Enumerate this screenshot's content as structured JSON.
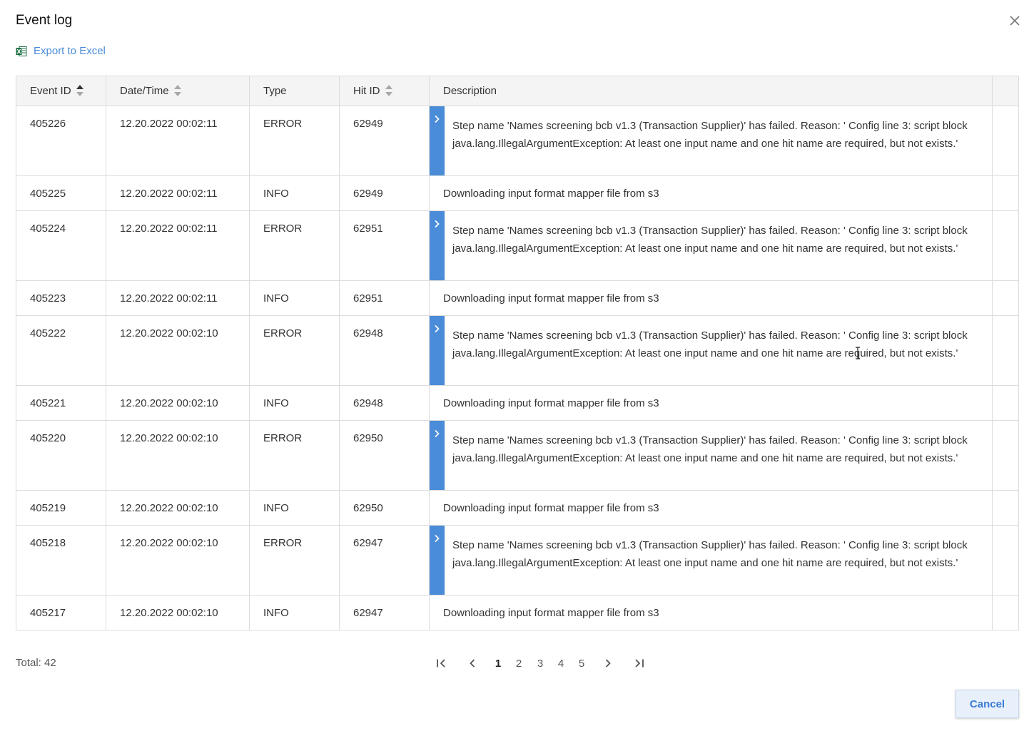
{
  "dialog": {
    "title": "Event log"
  },
  "toolbar": {
    "export_label": "Export to Excel"
  },
  "table": {
    "columns": [
      "Event ID",
      "Date/Time",
      "Type",
      "Hit ID",
      "Description"
    ],
    "rows": [
      {
        "id": "405226",
        "datetime": "12.20.2022 00:02:11",
        "type": "ERROR",
        "hit": "62949",
        "desc": "Step name 'Names screening bcb v1.3 (Transaction Supplier)' has failed. Reason: ' Config line 3: script block java.lang.IllegalArgumentException: At least one input name and one hit name are required, but not exists.'"
      },
      {
        "id": "405225",
        "datetime": "12.20.2022 00:02:11",
        "type": "INFO",
        "hit": "62949",
        "desc": "Downloading input format mapper file from s3"
      },
      {
        "id": "405224",
        "datetime": "12.20.2022 00:02:11",
        "type": "ERROR",
        "hit": "62951",
        "desc": "Step name 'Names screening bcb v1.3 (Transaction Supplier)' has failed. Reason: ' Config line 3: script block java.lang.IllegalArgumentException: At least one input name and one hit name are required, but not exists.'"
      },
      {
        "id": "405223",
        "datetime": "12.20.2022 00:02:11",
        "type": "INFO",
        "hit": "62951",
        "desc": "Downloading input format mapper file from s3"
      },
      {
        "id": "405222",
        "datetime": "12.20.2022 00:02:10",
        "type": "ERROR",
        "hit": "62948",
        "desc": "Step name 'Names screening bcb v1.3 (Transaction Supplier)' has failed. Reason: ' Config line 3: script block java.lang.IllegalArgumentException: At least one input name and one hit name are required, but not exists.'"
      },
      {
        "id": "405221",
        "datetime": "12.20.2022 00:02:10",
        "type": "INFO",
        "hit": "62948",
        "desc": "Downloading input format mapper file from s3"
      },
      {
        "id": "405220",
        "datetime": "12.20.2022 00:02:10",
        "type": "ERROR",
        "hit": "62950",
        "desc": "Step name 'Names screening bcb v1.3 (Transaction Supplier)' has failed. Reason: ' Config line 3: script block java.lang.IllegalArgumentException: At least one input name and one hit name are required, but not exists.'"
      },
      {
        "id": "405219",
        "datetime": "12.20.2022 00:02:10",
        "type": "INFO",
        "hit": "62950",
        "desc": "Downloading input format mapper file from s3"
      },
      {
        "id": "405218",
        "datetime": "12.20.2022 00:02:10",
        "type": "ERROR",
        "hit": "62947",
        "desc": "Step name 'Names screening bcb v1.3 (Transaction Supplier)' has failed. Reason: ' Config line 3: script block java.lang.IllegalArgumentException: At least one input name and one hit name are required, but not exists.'"
      },
      {
        "id": "405217",
        "datetime": "12.20.2022 00:02:10",
        "type": "INFO",
        "hit": "62947",
        "desc": "Downloading input format mapper file from s3"
      }
    ]
  },
  "footer": {
    "total_label": "Total: 42",
    "pages": [
      "1",
      "2",
      "3",
      "4",
      "5"
    ],
    "current_page": "1",
    "cancel_label": "Cancel"
  },
  "colors": {
    "accent": "#4a8cd8",
    "excel_green": "#1d7044"
  },
  "icons": {
    "close": "close-icon",
    "export": "excel-icon",
    "expand": "chevron-right-icon",
    "first": "first-page-icon",
    "prev": "chevron-left-icon",
    "next": "chevron-right-icon",
    "last": "last-page-icon"
  }
}
